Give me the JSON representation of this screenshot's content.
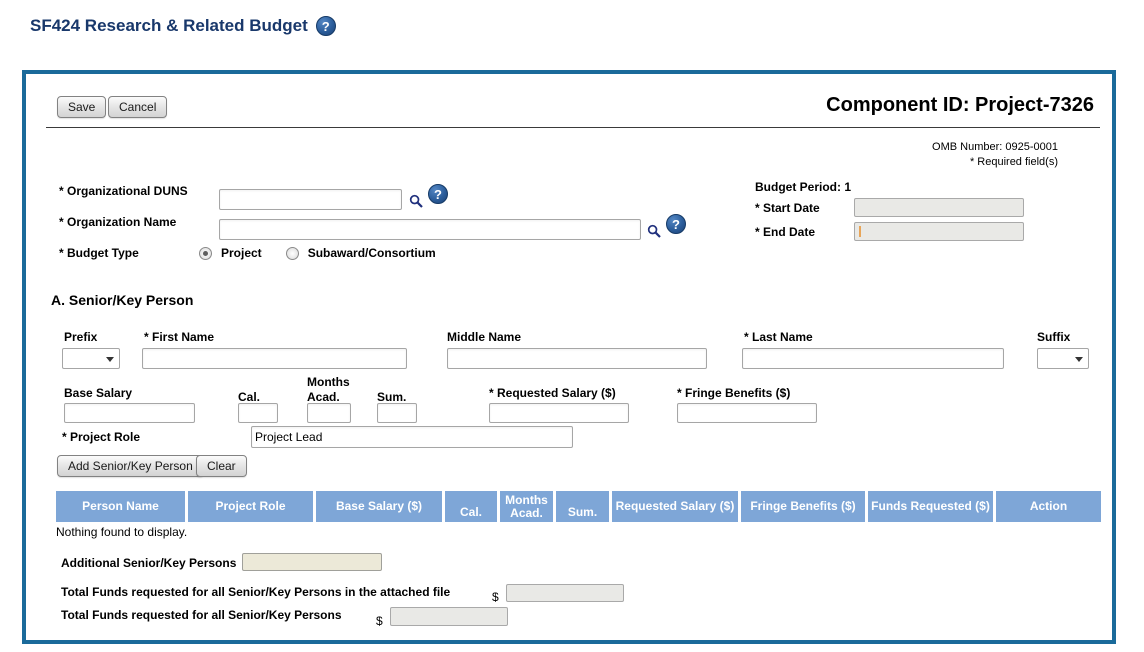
{
  "page_title": "SF424 Research & Related Budget",
  "help_icon_glyph": "?",
  "actions": {
    "save": "Save",
    "cancel": "Cancel",
    "add_person": "Add Senior/Key Person",
    "clear": "Clear"
  },
  "header": {
    "component_id": "Component ID: Project-7326",
    "omb_number": "OMB Number: 0925-0001",
    "required_note": "* Required field(s)"
  },
  "org_fields": {
    "duns_label": "* Organizational DUNS",
    "duns_value": "",
    "name_label": "* Organization Name",
    "name_value": "",
    "budget_type_label": "* Budget Type",
    "budget_type_options": [
      "Project",
      "Subaward/Consortium"
    ],
    "budget_type_selected": "Project"
  },
  "budget_period": {
    "label": "Budget Period: 1",
    "start_label": "* Start Date",
    "start_value": "",
    "end_label": "* End Date",
    "end_value": ""
  },
  "senior_key_person": {
    "heading": "A. Senior/Key Person",
    "prefix_label": "Prefix",
    "first_name_label": "* First Name",
    "first_name_value": "",
    "middle_name_label": "Middle Name",
    "middle_name_value": "",
    "last_name_label": "* Last Name",
    "last_name_value": "",
    "suffix_label": "Suffix",
    "base_salary_label": "Base Salary",
    "base_salary_value": "",
    "cal_label": "Cal.",
    "months_label": "Months",
    "acad_label": "Acad.",
    "sum_label": "Sum.",
    "cal_value": "",
    "acad_value": "",
    "sum_value": "",
    "requested_salary_label": "* Requested Salary ($)",
    "requested_salary_value": "",
    "fringe_benefits_label": "* Fringe Benefits ($)",
    "fringe_benefits_value": "",
    "project_role_label": "* Project Role",
    "project_role_value": "Project Lead"
  },
  "persons_table": {
    "headers": [
      "Person Name",
      "Project Role",
      "Base Salary ($)",
      "Cal.",
      "Months Acad.",
      "Sum.",
      "Requested Salary ($)",
      "Fringe Benefits ($)",
      "Funds Requested ($)",
      "Action"
    ],
    "empty_text": "Nothing found to display."
  },
  "totals": {
    "additional_label": "Additional Senior/Key Persons",
    "additional_value": "",
    "attached_total_label": "Total Funds requested for all Senior/Key Persons in the attached file",
    "attached_total_value": "",
    "overall_total_label": "Total Funds requested for all Senior/Key Persons",
    "overall_total_value": "",
    "currency_symbol": "$"
  },
  "colors": {
    "panel_border": "#1A6A9A",
    "table_header_bg": "#7EA6D7",
    "title_navy": "#19386B",
    "help_icon_blue": "#2B5D9B",
    "disabled_field_bg": "#E9E9E6",
    "attach_field_bg": "#ECE9D8"
  }
}
